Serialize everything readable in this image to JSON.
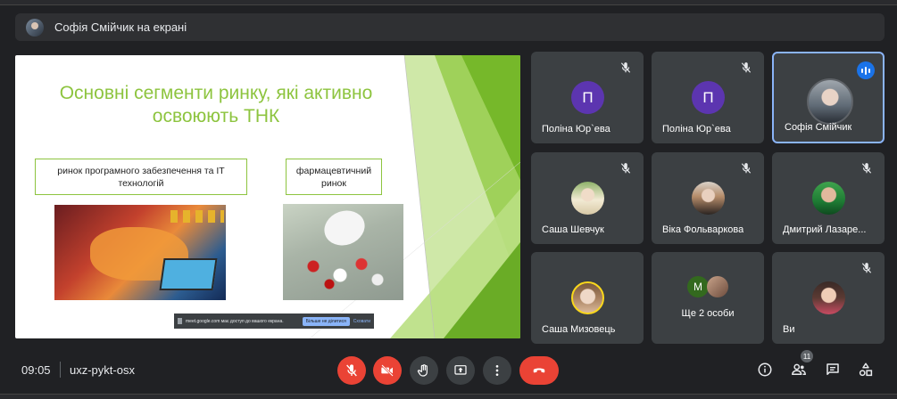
{
  "presenter": {
    "text": "Софія Смійчик на екрані"
  },
  "slide": {
    "title": "Основні сегменти ринку, які активно освоюють ТНК",
    "segment_1": "ринок програмного забезпечення та IT технологій",
    "segment_2": "фармацевтичний ринок",
    "share_notice": {
      "text": "meet.google.com має доступ до вашого екрана.",
      "stop_label": "Більше не ділитися",
      "hide_label": "Сховати"
    }
  },
  "participants": [
    {
      "name": "Поліна Юр`ева",
      "avatar": "П",
      "muted": true
    },
    {
      "name": "Поліна Юр`ева",
      "avatar": "П",
      "muted": true
    },
    {
      "name": "Софія Смійчик",
      "avatar": "photo",
      "muted": false,
      "speaking": true
    },
    {
      "name": "Саша Шевчук",
      "avatar": "photo",
      "muted": true
    },
    {
      "name": "Віка Фольваркова",
      "avatar": "photo",
      "muted": true
    },
    {
      "name": "Дмитрий Лазаре...",
      "avatar": "photo",
      "muted": true
    },
    {
      "name": "Саша Мизовець",
      "avatar": "photo",
      "muted": false
    },
    {
      "more_label": "Ще 2 особи",
      "avatar_letter": "М"
    },
    {
      "name": "Ви",
      "avatar": "photo",
      "muted": true
    }
  ],
  "bottom_bar": {
    "time": "09:05",
    "meeting_code": "uxz-pykt-osx",
    "participants_count": "11"
  },
  "colors": {
    "accent_green": "#8dc43f",
    "danger_red": "#ea4335",
    "active_blue": "#8ab4f8",
    "avatar_purple": "#5c35b0"
  }
}
